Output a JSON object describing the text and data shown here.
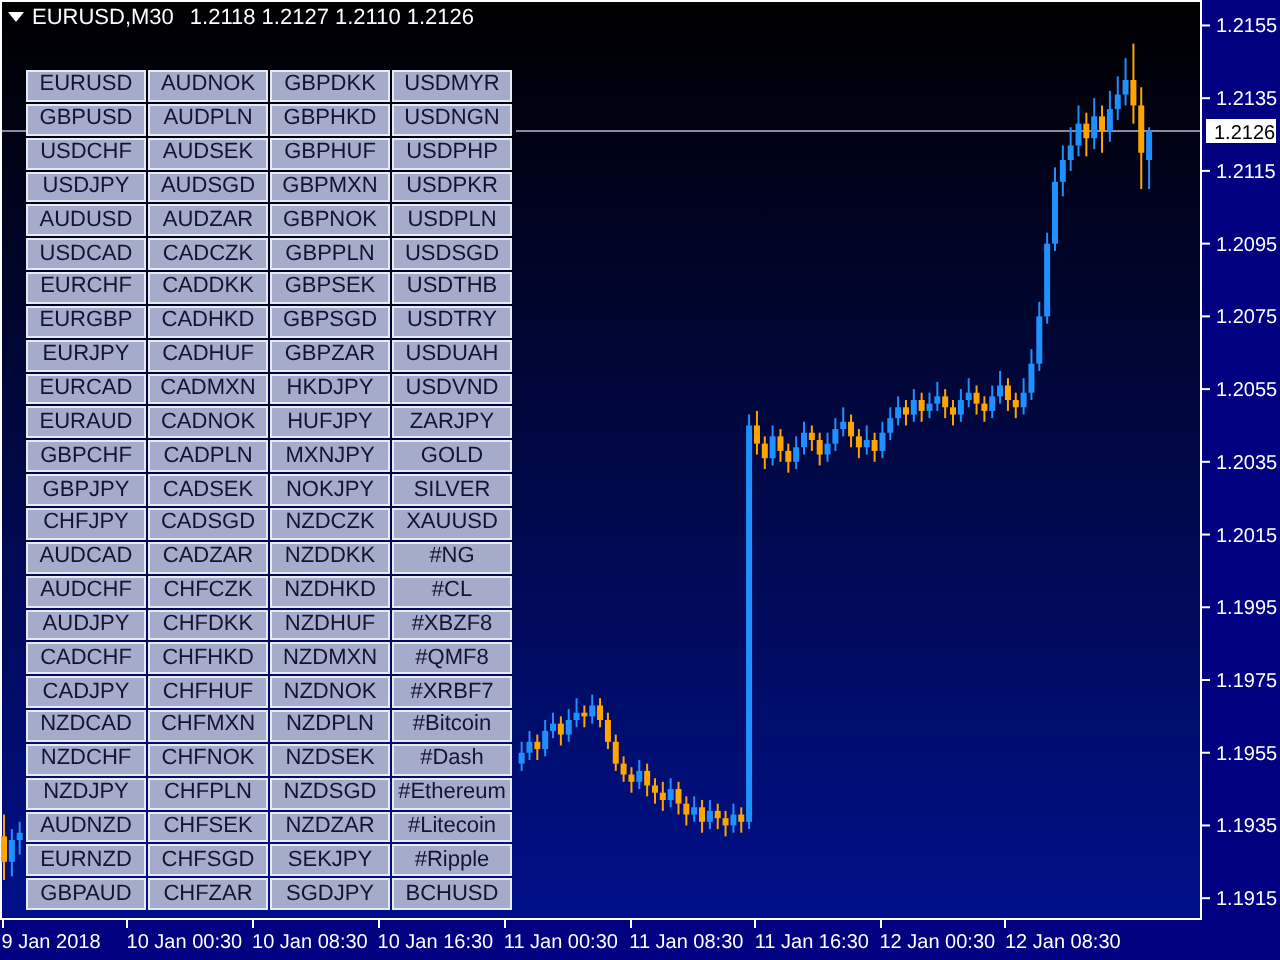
{
  "window": {
    "title": "EURUSD,M30",
    "ohlc": "1.2118 1.2127 1.2110 1.2126"
  },
  "symbol_buttons": [
    [
      "EURUSD",
      "AUDNOK",
      "GBPDKK",
      "USDMYR"
    ],
    [
      "GBPUSD",
      "AUDPLN",
      "GBPHKD",
      "USDNGN"
    ],
    [
      "USDCHF",
      "AUDSEK",
      "GBPHUF",
      "USDPHP"
    ],
    [
      "USDJPY",
      "AUDSGD",
      "GBPMXN",
      "USDPKR"
    ],
    [
      "AUDUSD",
      "AUDZAR",
      "GBPNOK",
      "USDPLN"
    ],
    [
      "USDCAD",
      "CADCZK",
      "GBPPLN",
      "USDSGD"
    ],
    [
      "EURCHF",
      "CADDKK",
      "GBPSEK",
      "USDTHB"
    ],
    [
      "EURGBP",
      "CADHKD",
      "GBPSGD",
      "USDTRY"
    ],
    [
      "EURJPY",
      "CADHUF",
      "GBPZAR",
      "USDUAH"
    ],
    [
      "EURCAD",
      "CADMXN",
      "HKDJPY",
      "USDVND"
    ],
    [
      "EURAUD",
      "CADNOK",
      "HUFJPY",
      "ZARJPY"
    ],
    [
      "GBPCHF",
      "CADPLN",
      "MXNJPY",
      "GOLD"
    ],
    [
      "GBPJPY",
      "CADSEK",
      "NOKJPY",
      "SILVER"
    ],
    [
      "CHFJPY",
      "CADSGD",
      "NZDCZK",
      "XAUUSD"
    ],
    [
      "AUDCAD",
      "CADZAR",
      "NZDDKK",
      "#NG"
    ],
    [
      "AUDCHF",
      "CHFCZK",
      "NZDHKD",
      "#CL"
    ],
    [
      "AUDJPY",
      "CHFDKK",
      "NZDHUF",
      "#XBZF8"
    ],
    [
      "CADCHF",
      "CHFHKD",
      "NZDMXN",
      "#QMF8"
    ],
    [
      "CADJPY",
      "CHFHUF",
      "NZDNOK",
      "#XRBF7"
    ],
    [
      "NZDCAD",
      "CHFMXN",
      "NZDPLN",
      "#Bitcoin"
    ],
    [
      "NZDCHF",
      "CHFNOK",
      "NZDSEK",
      "#Dash"
    ],
    [
      "NZDJPY",
      "CHFPLN",
      "NZDSGD",
      "#Ethereum"
    ],
    [
      "AUDNZD",
      "CHFSEK",
      "NZDZAR",
      "#Litecoin"
    ],
    [
      "EURNZD",
      "CHFSGD",
      "SEKJPY",
      "#Ripple"
    ],
    [
      "GBPAUD",
      "CHFZAR",
      "SGDJPY",
      "BCHUSD"
    ]
  ],
  "price_axis": {
    "current_price": "1.2126"
  },
  "chart_data": {
    "type": "candlestick",
    "ylim": [
      1.1909,
      1.2162
    ],
    "yticks": [
      {
        "value": 1.2155,
        "label": "1.2155"
      },
      {
        "value": 1.2135,
        "label": "1.2135"
      },
      {
        "value": 1.2115,
        "label": "1.2115"
      },
      {
        "value": 1.2095,
        "label": "1.2095"
      },
      {
        "value": 1.2075,
        "label": "1.2075"
      },
      {
        "value": 1.2055,
        "label": "1.2055"
      },
      {
        "value": 1.2035,
        "label": "1.2035"
      },
      {
        "value": 1.2015,
        "label": "1.2015"
      },
      {
        "value": 1.1995,
        "label": "1.1995"
      },
      {
        "value": 1.1975,
        "label": "1.1975"
      },
      {
        "value": 1.1955,
        "label": "1.1955"
      },
      {
        "value": 1.1935,
        "label": "1.1935"
      },
      {
        "value": 1.1915,
        "label": "1.1915"
      }
    ],
    "categories": [
      null,
      null,
      null,
      null,
      null,
      null,
      "9 Jan 2018",
      null,
      null,
      null,
      null,
      null,
      null,
      null,
      null,
      null,
      null,
      null,
      null,
      null,
      null,
      null,
      null,
      "10 Jan 00:30",
      null,
      null,
      null,
      null,
      null,
      null,
      null,
      null,
      null,
      null,
      null,
      null,
      null,
      null,
      null,
      "10 Jan 08:30",
      null,
      null,
      null,
      null,
      null,
      null,
      null,
      null,
      null,
      null,
      null,
      null,
      null,
      null,
      null,
      "10 Jan 16:30",
      null,
      null,
      null,
      null,
      null,
      null,
      null,
      null,
      null,
      null,
      null,
      null,
      null,
      null,
      null,
      "11 Jan 00:30",
      null,
      null,
      null,
      null,
      null,
      null,
      null,
      null,
      null,
      null,
      null,
      null,
      null,
      null,
      null,
      "11 Jan 08:30",
      null,
      null,
      null,
      null,
      null,
      null,
      null,
      null,
      null,
      null,
      null,
      null,
      null,
      null,
      null,
      "11 Jan 16:30",
      null,
      null,
      null,
      null,
      null,
      null,
      null,
      null,
      null,
      null,
      null,
      null,
      null,
      null,
      null,
      "12 Jan 00:30",
      null,
      null,
      null,
      null,
      null,
      null,
      null,
      null,
      null,
      null,
      null,
      null,
      null,
      null,
      null,
      "12 Jan 08:30",
      null,
      null,
      null,
      null,
      null,
      null,
      null,
      null,
      null,
      null,
      null
    ],
    "ohlc": [
      [
        1.1932,
        1.1938,
        1.192,
        1.1925
      ],
      [
        1.1925,
        1.1934,
        1.1921,
        1.1931
      ],
      [
        1.1931,
        1.1936,
        1.1927,
        1.1933
      ],
      null,
      null,
      null,
      null,
      null,
      null,
      null,
      null,
      null,
      null,
      null,
      null,
      null,
      null,
      null,
      null,
      null,
      null,
      null,
      null,
      null,
      null,
      null,
      null,
      null,
      null,
      null,
      null,
      null,
      null,
      null,
      null,
      null,
      null,
      null,
      null,
      null,
      null,
      null,
      null,
      null,
      null,
      null,
      null,
      null,
      null,
      null,
      null,
      null,
      null,
      null,
      null,
      null,
      null,
      null,
      null,
      null,
      null,
      null,
      null,
      null,
      null,
      null,
      [
        1.1952,
        1.1958,
        1.195,
        1.1955
      ],
      [
        1.1955,
        1.1961,
        1.1953,
        1.1958
      ],
      [
        1.1958,
        1.196,
        1.1953,
        1.1956
      ],
      [
        1.1956,
        1.1964,
        1.1954,
        1.1961
      ],
      [
        1.1961,
        1.1966,
        1.1959,
        1.1963
      ],
      [
        1.1963,
        1.1965,
        1.1957,
        1.196
      ],
      [
        1.196,
        1.1967,
        1.1958,
        1.1964
      ],
      [
        1.1964,
        1.197,
        1.1962,
        1.1966
      ],
      [
        1.1966,
        1.1968,
        1.1962,
        1.1965
      ],
      [
        1.1965,
        1.1971,
        1.1963,
        1.1968
      ],
      [
        1.1968,
        1.197,
        1.1962,
        1.1964
      ],
      [
        1.1964,
        1.1966,
        1.1956,
        1.1958
      ],
      [
        1.1958,
        1.196,
        1.195,
        1.1952
      ],
      [
        1.1952,
        1.1954,
        1.1947,
        1.1949
      ],
      [
        1.1949,
        1.1951,
        1.1944,
        1.1947
      ],
      [
        1.1947,
        1.1953,
        1.1945,
        1.195
      ],
      [
        1.195,
        1.1952,
        1.1943,
        1.1946
      ],
      [
        1.1946,
        1.1948,
        1.1941,
        1.1944
      ],
      [
        1.1944,
        1.1947,
        1.1939,
        1.1942
      ],
      [
        1.1942,
        1.1948,
        1.194,
        1.1945
      ],
      [
        1.1945,
        1.1947,
        1.1938,
        1.1941
      ],
      [
        1.1941,
        1.1943,
        1.1935,
        1.1938
      ],
      [
        1.1938,
        1.1943,
        1.1936,
        1.194
      ],
      [
        1.194,
        1.1942,
        1.1933,
        1.1936
      ],
      [
        1.1936,
        1.1942,
        1.1934,
        1.1939
      ],
      [
        1.1939,
        1.1941,
        1.1934,
        1.1937
      ],
      [
        1.1937,
        1.1939,
        1.1932,
        1.1935
      ],
      [
        1.1935,
        1.1941,
        1.1933,
        1.1938
      ],
      [
        1.1938,
        1.194,
        1.1933,
        1.1936
      ],
      [
        1.1936,
        1.2048,
        1.1934,
        1.2045
      ],
      [
        1.2045,
        1.2049,
        1.2037,
        1.204
      ],
      [
        1.204,
        1.2042,
        1.2033,
        1.2036
      ],
      [
        1.2036,
        1.2045,
        1.2034,
        1.2042
      ],
      [
        1.2042,
        1.2044,
        1.2035,
        1.2038
      ],
      [
        1.2038,
        1.204,
        1.2032,
        1.2035
      ],
      [
        1.2035,
        1.2042,
        1.2033,
        1.2039
      ],
      [
        1.2039,
        1.2046,
        1.2037,
        1.2043
      ],
      [
        1.2043,
        1.2045,
        1.2038,
        1.2041
      ],
      [
        1.2041,
        1.2043,
        1.2034,
        1.2037
      ],
      [
        1.2037,
        1.2043,
        1.2035,
        1.204
      ],
      [
        1.204,
        1.2047,
        1.2038,
        1.2044
      ],
      [
        1.2044,
        1.205,
        1.2042,
        1.2046
      ],
      [
        1.2046,
        1.2048,
        1.2039,
        1.2042
      ],
      [
        1.2042,
        1.2044,
        1.2036,
        1.2039
      ],
      [
        1.2039,
        1.2045,
        1.2037,
        1.2041
      ],
      [
        1.2041,
        1.2043,
        1.2035,
        1.2038
      ],
      [
        1.2038,
        1.2046,
        1.2036,
        1.2043
      ],
      [
        1.2043,
        1.205,
        1.2041,
        1.2047
      ],
      [
        1.2047,
        1.2053,
        1.2045,
        1.205
      ],
      [
        1.205,
        1.2052,
        1.2045,
        1.2048
      ],
      [
        1.2048,
        1.2055,
        1.2046,
        1.2052
      ],
      [
        1.2052,
        1.2054,
        1.2046,
        1.2049
      ],
      [
        1.2049,
        1.2054,
        1.2047,
        1.2051
      ],
      [
        1.2051,
        1.2057,
        1.2049,
        1.2053
      ],
      [
        1.2053,
        1.2055,
        1.2047,
        1.205
      ],
      [
        1.205,
        1.2052,
        1.2045,
        1.2048
      ],
      [
        1.2048,
        1.2055,
        1.2046,
        1.2052
      ],
      [
        1.2052,
        1.2058,
        1.205,
        1.2054
      ],
      [
        1.2054,
        1.2056,
        1.2048,
        1.2051
      ],
      [
        1.2051,
        1.2053,
        1.2046,
        1.2049
      ],
      [
        1.2049,
        1.2056,
        1.2047,
        1.2053
      ],
      [
        1.2053,
        1.206,
        1.2051,
        1.2056
      ],
      [
        1.2056,
        1.2058,
        1.2049,
        1.2052
      ],
      [
        1.2052,
        1.2054,
        1.2047,
        1.205
      ],
      [
        1.205,
        1.2058,
        1.2048,
        1.2054
      ],
      [
        1.2054,
        1.2066,
        1.2052,
        1.2062
      ],
      [
        1.2062,
        1.2079,
        1.206,
        1.2075
      ],
      [
        1.2075,
        1.2098,
        1.2073,
        1.2095
      ],
      [
        1.2095,
        1.2116,
        1.2093,
        1.2112
      ],
      [
        1.2112,
        1.2122,
        1.2108,
        1.2118
      ],
      [
        1.2118,
        1.2127,
        1.2115,
        1.2122
      ],
      [
        1.2122,
        1.2133,
        1.2119,
        1.2128
      ],
      [
        1.2128,
        1.2131,
        1.2119,
        1.2124
      ],
      [
        1.2124,
        1.2135,
        1.2121,
        1.213
      ],
      [
        1.213,
        1.2133,
        1.212,
        1.2126
      ],
      [
        1.2126,
        1.2137,
        1.2123,
        1.2132
      ],
      [
        1.2132,
        1.2141,
        1.2129,
        1.2136
      ],
      [
        1.2136,
        1.2146,
        1.2133,
        1.214
      ],
      [
        1.214,
        1.215,
        1.2128,
        1.2133
      ],
      [
        1.2133,
        1.2138,
        1.211,
        1.212
      ],
      [
        1.2118,
        1.2127,
        1.211,
        1.2126
      ]
    ]
  }
}
